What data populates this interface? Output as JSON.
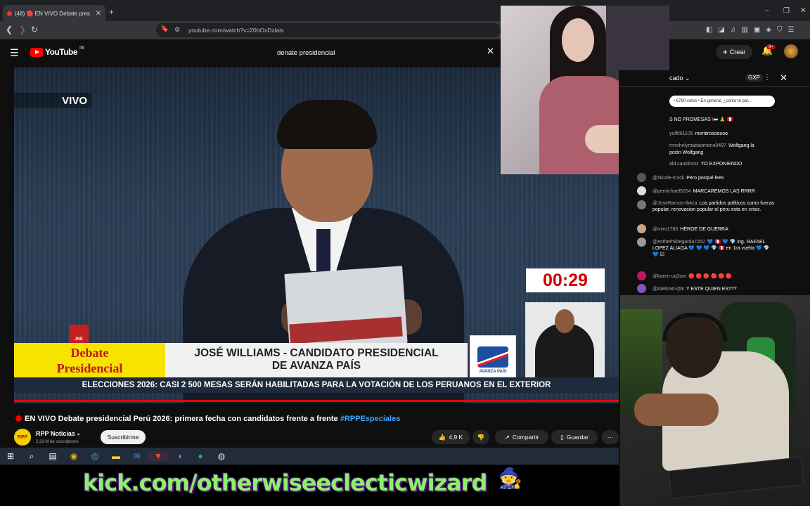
{
  "browser": {
    "tab_title": "(48) 🔴 EN VIVO Debate pres",
    "url": "youtube.com/watch?v=20bOxDzlais",
    "new_tab": "+",
    "window_controls": [
      "–",
      "❐",
      "✕"
    ]
  },
  "youtube": {
    "logo_text": "YouTube",
    "logo_sub": "PE",
    "search_value": "denate presidencial",
    "create_label": "Crear",
    "notifications_badge": "9+"
  },
  "video": {
    "live_label": "VIVO",
    "timer": "00:29",
    "lower_third_left_1": "Debate",
    "lower_third_left_2": "Presidencial",
    "lower_third_main_1": "JOSÉ WILLIAMS - CANDIDATO PRESIDENCIAL",
    "lower_third_main_2": "DE AVANZA PAÍS",
    "party_logo_label": "AVANZA PAÍS",
    "jne_label": "JNE",
    "ticker": "ELECCIONES 2026: CASI 2 500 MESAS SERÁN HABILITADAS PARA LA VOTACIÓN DE LOS PERUANOS EN EL EXTERIOR",
    "progress_fraction": 1.0
  },
  "info": {
    "title": "EN VIVO Debate presidencial Perú 2026: primera fecha con candidatos frente a frente",
    "hashtag": "#RPPEspeciales",
    "channel_name": "RPP Noticias",
    "channel_avatar": "RPP",
    "subscribers": "2,33 M de suscriptores",
    "subscribe_label": "Suscribirme",
    "likes": "4,9 K",
    "share_label": "Compartir",
    "save_label": "Guardar"
  },
  "chat": {
    "header_label": "cado",
    "gxp_label": "GXP",
    "pinned": "• 6780 votos • En general, ¿cómo te par...",
    "messages": [
      {
        "user": "",
        "text": "S NO PROMESAS 🇵🇸 🙏 🇵🇪"
      },
      {
        "user": "yolf061105",
        "text": "mentirosooooo"
      },
      {
        "user": "mnohelymattaomeno9497",
        "text": "Wolfgang la"
      },
      {
        "user": "",
        "text": "pción Wolfgang"
      },
      {
        "user": "ald.cauldronz",
        "text": "YO EXPONIENDO"
      },
      {
        "user": "@Nicole-tc3ck",
        "text": "Pero porqué lees"
      },
      {
        "user": "@pemichael5264",
        "text": "MARCAREMOS LAS RRRR"
      },
      {
        "user": "@JoseRamos-tb4za",
        "text": "Los partidos políticos como fuerza popular, renovacion popular el peru esta en crisis."
      },
      {
        "user": "@miro1780",
        "text": "HEROE DE GUERRA"
      },
      {
        "user": "@estherhildegarda7252",
        "text": "💙 🇵🇪 💙 💎 ing. RAFAEL LOPEZ ALIAGA 💙 💙 💙 💎 🇵🇪 en 1ra vuelta 💙 💎 💙 ☑"
      },
      {
        "user": "@karen-uq3sm",
        "text": "🔴 🔴 🔴 🔴 🔴 🔴"
      },
      {
        "user": "@Alebrad-q5k",
        "text": "Y ESTE QUIEN ES???"
      }
    ]
  },
  "banner": {
    "text": "kick.com/otherwiseeclecticwizard"
  },
  "taskbar": {
    "icons": [
      "windows-icon",
      "search-icon",
      "taskview-icon",
      "chrome-icon",
      "edge-icon",
      "explorer-icon",
      "outlook-icon",
      "brave-icon",
      "discord-icon",
      "spotify-icon",
      "obs-icon"
    ]
  }
}
